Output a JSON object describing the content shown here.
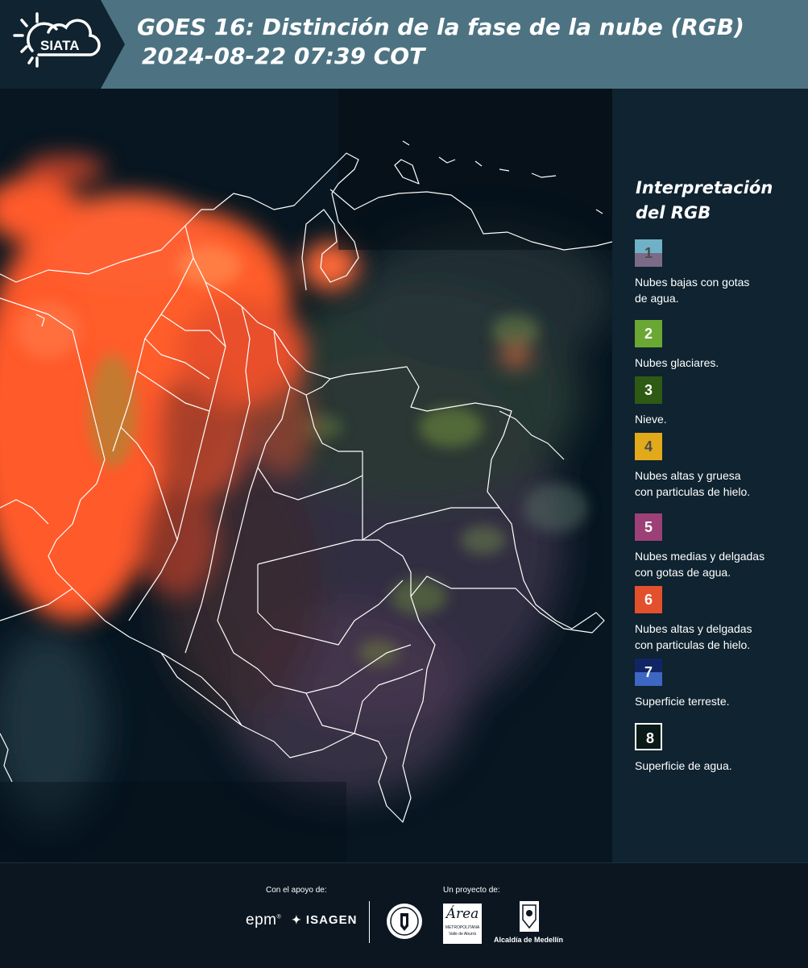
{
  "header": {
    "logo_text": "SIATA",
    "title_line1": "GOES 16: Distinción de la fase de la nube (RGB)",
    "title_line2": "2024-08-22 07:39 COT"
  },
  "legend": {
    "title_line1": "Interpretación",
    "title_line2": "del RGB",
    "items": [
      {
        "num": "1",
        "label_line1": "Nubes bajas con gotas",
        "label_line2": "de agua.",
        "colors": [
          "#6fb1c6",
          "#7b6b86"
        ],
        "num_color": "#4a4a4a"
      },
      {
        "num": "2",
        "label_line1": "Nubes glaciares.",
        "label_line2": "",
        "colors": [
          "#6aa733"
        ],
        "num_color": "#ffffff"
      },
      {
        "num": "3",
        "label_line1": "Nieve.",
        "label_line2": "",
        "colors": [
          "#2e5a14"
        ],
        "num_color": "#ffffff"
      },
      {
        "num": "4",
        "label_line1": "Nubes altas y gruesa",
        "label_line2": "con particulas de hielo.",
        "colors": [
          "#e2aa1a"
        ],
        "num_color": "#4a4a4a"
      },
      {
        "num": "5",
        "label_line1": "Nubes medias y delgadas",
        "label_line2": "con gotas de agua.",
        "colors": [
          "#9c4077"
        ],
        "num_color": "#ffffff"
      },
      {
        "num": "6",
        "label_line1": "Nubes altas y delgadas",
        "label_line2": "con particulas de hielo.",
        "colors": [
          "#e2502d"
        ],
        "num_color": "#ffffff"
      },
      {
        "num": "7",
        "label_line1": "Superficie terreste.",
        "label_line2": "",
        "colors": [
          "#112566",
          "#3d67c2"
        ],
        "num_color": "#ffffff"
      },
      {
        "num": "8",
        "label_line1": "Superficie de agua.",
        "label_line2": "",
        "colors": [
          "#0a1a16"
        ],
        "num_color": "#ffffff"
      }
    ]
  },
  "footer": {
    "support_label": "Con el apoyo de:",
    "project_label": "Un proyecto de:",
    "brand_epm": "epm",
    "brand_isagen": "ISAGEN",
    "brand_area_main": "Área",
    "brand_area_sub1": "METROPOLITANA",
    "brand_area_sub2": "Valle de Aburrá",
    "brand_medellin": "Alcaldía de Medellín"
  },
  "colors": {
    "header_bg": "#4d7382",
    "logo_bg": "#0f2330",
    "legend_bg": "#0f2330",
    "footer_bg": "#0b1620",
    "cloud_ice": "#ff5a2a",
    "border_lines": "#ffffff"
  }
}
